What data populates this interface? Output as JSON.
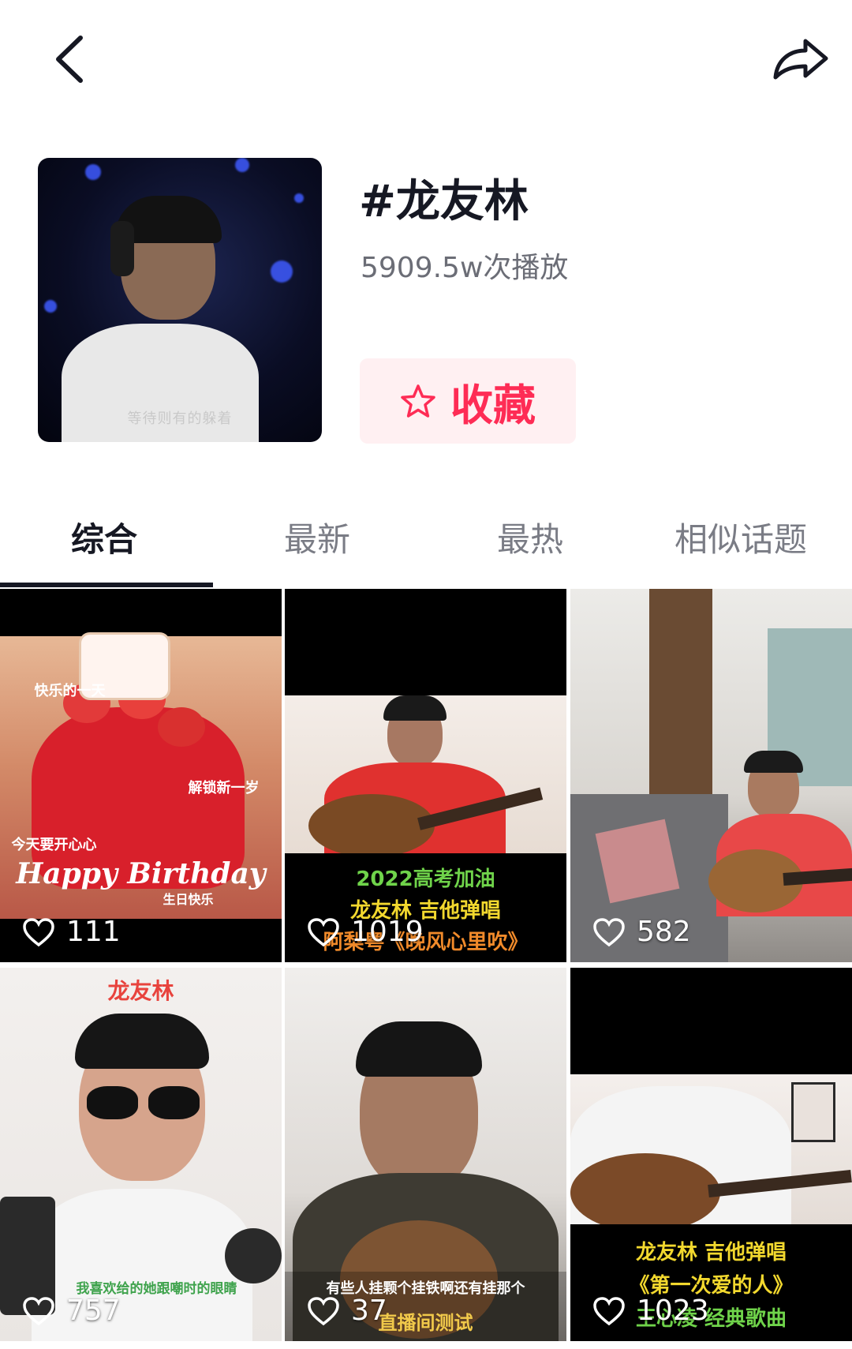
{
  "nav": {
    "back_icon": "chevron-left-icon",
    "share_icon": "share-arrow-icon"
  },
  "topic": {
    "title": "#龙友林",
    "play_count": "5909.5w次播放",
    "cover_caption": "等待则有的躲着",
    "favorite_label": "收藏",
    "favorite_icon": "star-outline-icon",
    "accent_color": "#fe2c55"
  },
  "tabs": [
    {
      "label": "综合",
      "active": true
    },
    {
      "label": "最新",
      "active": false
    },
    {
      "label": "最热",
      "active": false
    },
    {
      "label": "相似话题",
      "active": false
    }
  ],
  "videos": [
    {
      "likes": "111",
      "captions": [
        "Happy Birthday",
        "生日快乐",
        "解锁新一岁",
        "今天要开心心",
        "快乐的一天"
      ]
    },
    {
      "likes": "1019",
      "captions": [
        "2022高考加油",
        "龙友林 吉他弹唱",
        "阿梨粤《晚风心里吹》"
      ]
    },
    {
      "likes": "582",
      "captions": []
    },
    {
      "likes": "757",
      "captions": [
        "龙友林",
        "我喜欢给的她跟嘲时的眼睛"
      ]
    },
    {
      "likes": "37",
      "captions": [
        "有些人挂颗个挂铁啊还有挂那个",
        "直播间测试"
      ]
    },
    {
      "likes": "1023",
      "captions": [
        "龙友林 吉他弹唱",
        "《第一次爱的人》",
        "王心凌 经典歌曲"
      ]
    }
  ]
}
